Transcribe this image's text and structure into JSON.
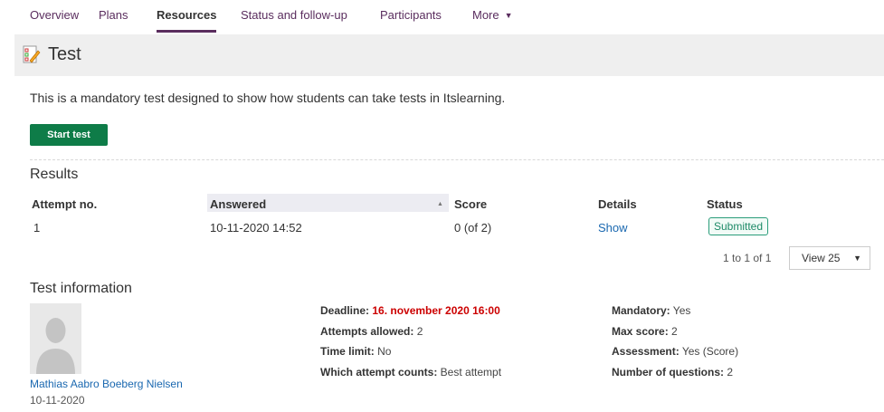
{
  "nav": {
    "tabs": [
      "Overview",
      "Plans",
      "Resources",
      "Status and follow-up",
      "Participants"
    ],
    "more_label": "More",
    "active": "Resources"
  },
  "page": {
    "title": "Test",
    "icon": "test-document-icon",
    "description": "This is a mandatory test designed to show how students can take tests in Itslearning.",
    "start_button": "Start test"
  },
  "results": {
    "heading": "Results",
    "columns": [
      "Attempt no.",
      "Answered",
      "Score",
      "Details",
      "Status"
    ],
    "sorted_column": "Answered",
    "rows": [
      {
        "attempt": "1",
        "answered": "10-11-2020 14:52",
        "score": "0 (of 2)",
        "details": "Show",
        "status": "Submitted"
      }
    ],
    "pager": "1 to 1 of 1",
    "view_select": "View 25"
  },
  "test_info": {
    "heading": "Test information",
    "person_name": "Mathias Aabro Boeberg Nielsen",
    "person_date": "10-11-2020",
    "left": [
      {
        "label": "Deadline:",
        "value": "16. november 2020 16:00"
      },
      {
        "label": "Attempts allowed:",
        "value": "2"
      },
      {
        "label": "Time limit:",
        "value": "No"
      },
      {
        "label": "Which attempt counts:",
        "value": "Best attempt"
      }
    ],
    "right": [
      {
        "label": "Mandatory:",
        "value": "Yes"
      },
      {
        "label": "Max score:",
        "value": "2"
      },
      {
        "label": "Assessment:",
        "value": "Yes (Score)"
      },
      {
        "label": "Number of questions:",
        "value": "2"
      }
    ]
  },
  "colors": {
    "accent": "#5a2d5e",
    "primary_button": "#0e7c48",
    "link": "#1a68b0",
    "deadline": "#cc0000",
    "status_badge": "#2a9d7a"
  }
}
